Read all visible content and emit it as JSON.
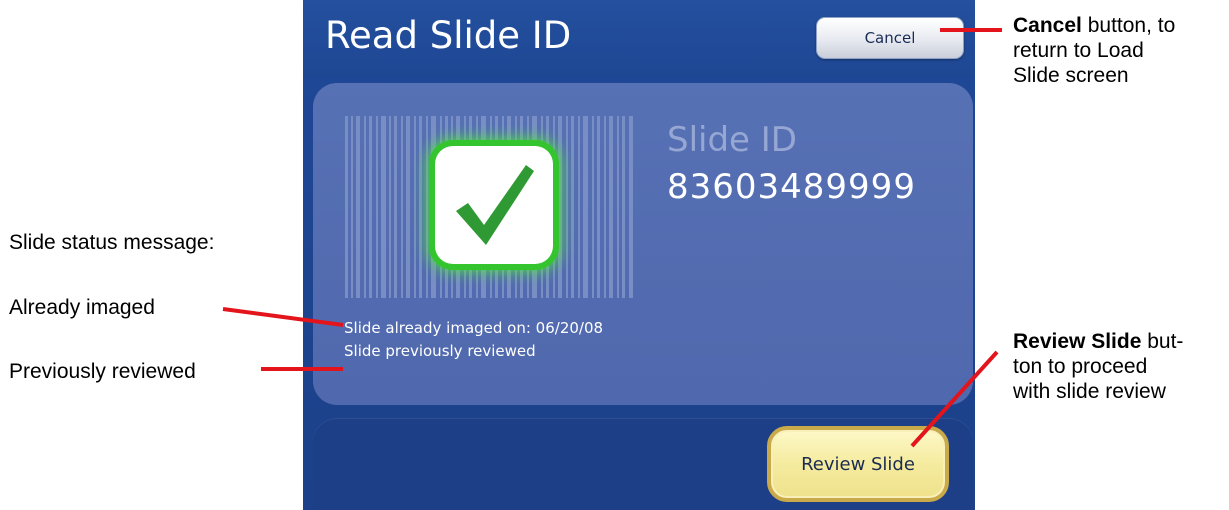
{
  "screen": {
    "title": "Read Slide ID",
    "cancel_label": "Cancel",
    "slide_id_label": "Slide ID",
    "slide_id_value": "83603489999",
    "status_imaged": "Slide already imaged on: 06/20/08",
    "status_reviewed": "Slide previously reviewed",
    "review_label": "Review Slide",
    "check_icon": "checkmark-icon",
    "barcode_icon": "barcode-icon"
  },
  "annotations": {
    "cancel_bold": "Cancel",
    "cancel_line1_rest": " button, to",
    "cancel_line2": "return to Load",
    "cancel_line3": "Slide screen",
    "status_heading": "Slide status message:",
    "already_imaged": "Already imaged",
    "previously_reviewed": "Previously reviewed",
    "review_bold": "Review Slide",
    "review_line1_rest": " but-",
    "review_line2": "ton to proceed",
    "review_line3": "with slide review"
  },
  "colors": {
    "screen_bg": "#1f4897",
    "panel": "#5670b4",
    "check_green": "#2f9a33",
    "callout_line": "#e3141b",
    "review_button": "#f5eb9f"
  }
}
